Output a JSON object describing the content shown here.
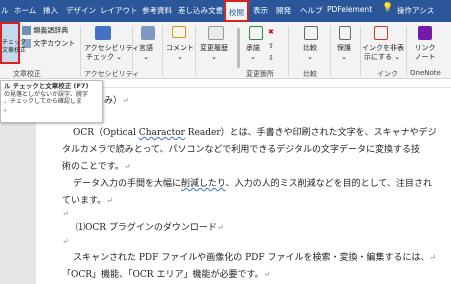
{
  "tabs": [
    {
      "label": "ル"
    },
    {
      "label": "ホーム"
    },
    {
      "label": "挿入"
    },
    {
      "label": "デザイン"
    },
    {
      "label": "レイアウト"
    },
    {
      "label": "参考資料"
    },
    {
      "label": "差し込み文書"
    },
    {
      "label": "校閲"
    },
    {
      "label": "表示"
    },
    {
      "label": "開発"
    },
    {
      "label": "ヘルプ"
    },
    {
      "label": "PDFelement"
    },
    {
      "label": "操作アシス"
    }
  ],
  "ribbon": {
    "spell_label_1": "チェック",
    "spell_label_2": "文章校正",
    "thesaurus": "類義語辞典",
    "wordcount": "文字カウント",
    "group_proofing": "文章校正",
    "accessibility_1": "アクセシビリティ",
    "accessibility_2": "チェック",
    "group_accessibility": "アクセシビリティ",
    "language": "言語",
    "comment": "コメント",
    "track_changes": "変更履歴",
    "accept": "承諾",
    "group_changes": "変更箇所",
    "compare": "比較",
    "group_compare": "比較",
    "protect": "保護",
    "ink_1": "インクを非表",
    "ink_2": "示にする",
    "group_ink": "インク",
    "onenote_1": "リンク",
    "onenote_2": "ノート",
    "group_onenote": "OneNote"
  },
  "tooltip": {
    "title": "ル チェックと文章校正 (F7)",
    "line1": "の見落としがないか誤字、脱字",
    "line2": "、チェックしてから確認しま",
    "line3": "。"
  },
  "document": {
    "heading": "理（プロ目線のみ）",
    "para1_a": "OCR（Optical ",
    "para1_b": "Charactor",
    "para1_c": " Reader）とは、手書きや印刷された文字を、スキャナやデジ",
    "para1_d": "タルカメラで読みとって、パソコンなどで利用できるデジタルの文字データに変換する技",
    "para1_e": "術のことです。",
    "para2_a": "データ入力の手間を大幅に",
    "para2_b": "削減したり",
    "para2_c": "、入力の人的ミス削減などを目的として、注目され",
    "para2_d": "ています。",
    "section": "⑴OCR プラグインのダウンロード",
    "para3_a": "スキャンされた PDF ファイルや画像化の PDF ファイルを検索・変換・編集するには、",
    "para3_b": "「OCR」機能、「OCR エリア」機能が必要です。",
    "mark": "↵"
  }
}
